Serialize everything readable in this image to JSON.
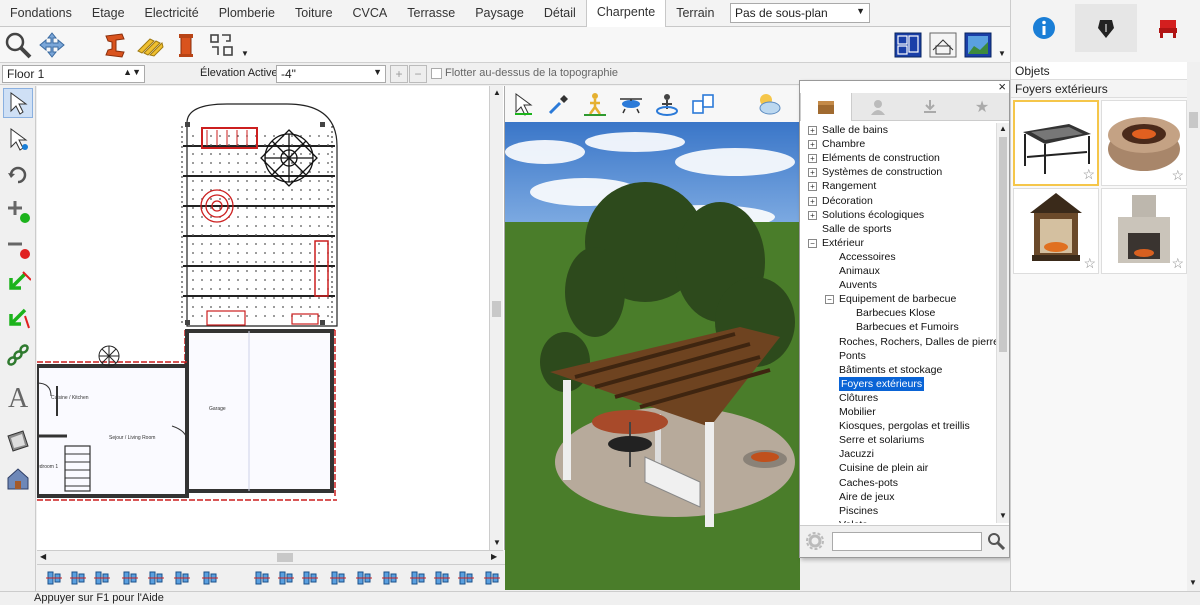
{
  "tabs": [
    "Fondations",
    "Etage",
    "Electricité",
    "Plomberie",
    "Toiture",
    "CVCA",
    "Terrasse",
    "Paysage",
    "Détail",
    "Charpente",
    "Terrain"
  ],
  "plan_select": "Pas de sous-plan",
  "floor_select": "Floor 1",
  "elevation_label": "Élevation Active:",
  "elevation_value": "-4\"",
  "float_label": "Flotter au-dessus de la topographie",
  "rooms": {
    "kitchen": "Cuisine / Kitchen",
    "living": "Sejour / Living Room",
    "garage": "Garage",
    "bedroom": "edroom 1"
  },
  "library": {
    "tree": [
      {
        "label": "Salle de bains",
        "level": 0,
        "exp": "+"
      },
      {
        "label": "Chambre",
        "level": 0,
        "exp": "+"
      },
      {
        "label": "Eléments de construction",
        "level": 0,
        "exp": "+"
      },
      {
        "label": "Systèmes de construction",
        "level": 0,
        "exp": "+"
      },
      {
        "label": "Rangement",
        "level": 0,
        "exp": "+"
      },
      {
        "label": "Décoration",
        "level": 0,
        "exp": "+"
      },
      {
        "label": "Solutions écologiques",
        "level": 0,
        "exp": "+"
      },
      {
        "label": "Salle de sports",
        "level": 0,
        "exp": ""
      },
      {
        "label": "Extérieur",
        "level": 0,
        "exp": "−"
      },
      {
        "label": "Accessoires",
        "level": 1,
        "exp": ""
      },
      {
        "label": "Animaux",
        "level": 1,
        "exp": ""
      },
      {
        "label": "Auvents",
        "level": 1,
        "exp": ""
      },
      {
        "label": "Equipement de barbecue",
        "level": 1,
        "exp": "−"
      },
      {
        "label": "Barbecues Klose",
        "level": 2,
        "exp": ""
      },
      {
        "label": "Barbecues et Fumoirs",
        "level": 2,
        "exp": ""
      },
      {
        "label": "Roches, Rochers, Dalles de pierre",
        "level": 1,
        "exp": ""
      },
      {
        "label": "Ponts",
        "level": 1,
        "exp": ""
      },
      {
        "label": "Bâtiments et stockage",
        "level": 1,
        "exp": ""
      },
      {
        "label": "Foyers extérieurs",
        "level": 1,
        "exp": "",
        "selected": true
      },
      {
        "label": "Clôtures",
        "level": 1,
        "exp": ""
      },
      {
        "label": "Mobilier",
        "level": 1,
        "exp": ""
      },
      {
        "label": "Kiosques, pergolas et treillis",
        "level": 1,
        "exp": ""
      },
      {
        "label": "Serre et solariums",
        "level": 1,
        "exp": ""
      },
      {
        "label": "Jacuzzi",
        "level": 1,
        "exp": ""
      },
      {
        "label": "Cuisine de plein air",
        "level": 1,
        "exp": ""
      },
      {
        "label": "Caches-pots",
        "level": 1,
        "exp": ""
      },
      {
        "label": "Aire de jeux",
        "level": 1,
        "exp": ""
      },
      {
        "label": "Piscines",
        "level": 1,
        "exp": ""
      },
      {
        "label": "Volets",
        "level": 1,
        "exp": ""
      }
    ],
    "search_placeholder": "",
    "close": "×"
  },
  "right_panel": {
    "category": "Objets",
    "subcategory": "Foyers extérieurs",
    "items": [
      "Fire pit table",
      "Round stone fire pit",
      "Lantern fireplace",
      "Stone outdoor fireplace"
    ]
  },
  "status": "Appuyer sur F1 pour l'Aide",
  "colors": {
    "accent": "#0a64d6",
    "highlight": "#f5c64a",
    "wall_red": "#cc1f1f"
  }
}
